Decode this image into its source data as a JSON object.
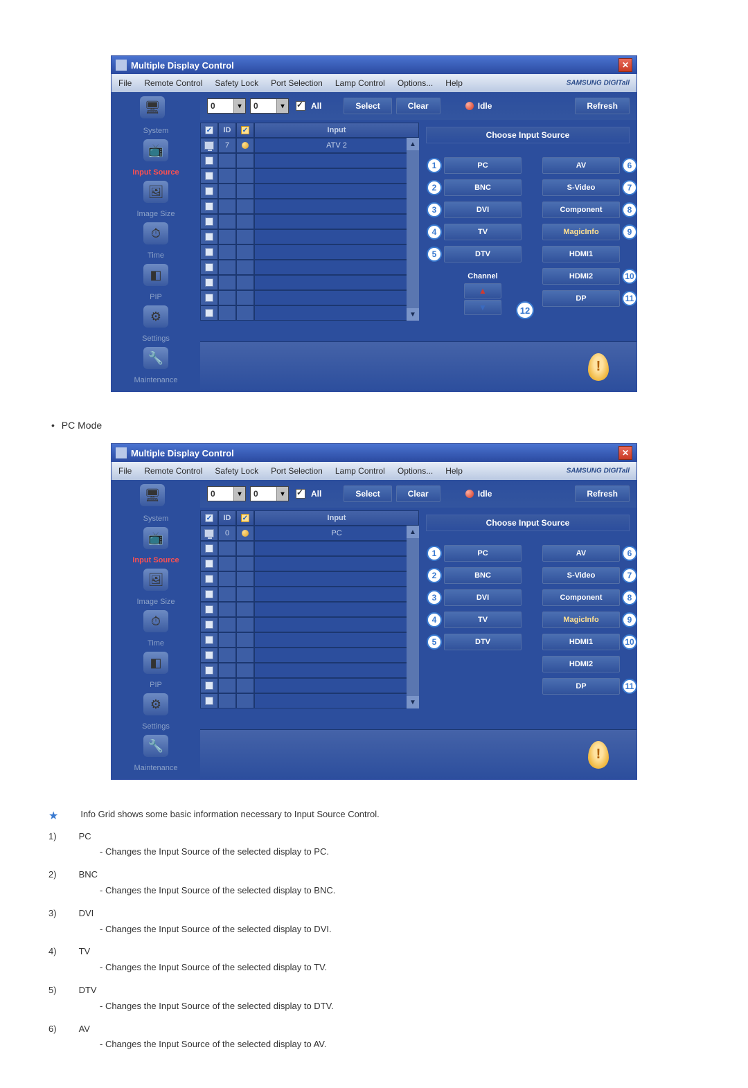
{
  "window": {
    "title": "Multiple Display Control",
    "brand": "SAMSUNG DIGITall"
  },
  "menu": {
    "file": "File",
    "remote": "Remote Control",
    "safety": "Safety Lock",
    "port": "Port Selection",
    "lamp": "Lamp Control",
    "options": "Options...",
    "help": "Help"
  },
  "toolbar": {
    "drop1": "0",
    "drop2": "0",
    "all_label": "All",
    "select": "Select",
    "clear": "Clear",
    "idle": "Idle",
    "refresh": "Refresh"
  },
  "sidebar": {
    "items": [
      {
        "label": "System"
      },
      {
        "label": "Input Source"
      },
      {
        "label": "Image Size"
      },
      {
        "label": "Time"
      },
      {
        "label": "PIP"
      },
      {
        "label": "Settings"
      },
      {
        "label": "Maintenance"
      }
    ]
  },
  "grid": {
    "headers": {
      "id": "ID",
      "input": "Input"
    },
    "screenshot1": {
      "row_id": "7",
      "row_input": "ATV 2"
    },
    "screenshot2": {
      "row_id": "0",
      "row_input": "PC"
    }
  },
  "right_panel": {
    "header": "Choose Input Source",
    "left_col": [
      "PC",
      "BNC",
      "DVI",
      "TV",
      "DTV"
    ],
    "right_col_full": [
      "AV",
      "S-Video",
      "Component",
      "MagicInfo",
      "HDMI1",
      "HDMI2",
      "DP"
    ],
    "right_col_second_extra": [
      "AV",
      "S-Video",
      "Component",
      "MagicInfo",
      "HDMI1",
      "HDMI2",
      "DP"
    ],
    "channel_label": "Channel"
  },
  "callouts": {
    "c1": "1",
    "c2": "2",
    "c3": "3",
    "c4": "4",
    "c5": "5",
    "c6": "6",
    "c7": "7",
    "c8": "8",
    "c9": "9",
    "c10": "10",
    "c11": "11",
    "c12": "12"
  },
  "mode_label": "PC Mode",
  "explain": {
    "star_text": "Info Grid shows some basic information necessary to Input Source Control.",
    "items": [
      {
        "num": "1)",
        "title": "PC",
        "desc": "- Changes the Input Source of the selected display to PC."
      },
      {
        "num": "2)",
        "title": "BNC",
        "desc": "- Changes the Input Source of the selected display to BNC."
      },
      {
        "num": "3)",
        "title": "DVI",
        "desc": "- Changes the Input Source of the selected display to DVI."
      },
      {
        "num": "4)",
        "title": "TV",
        "desc": "- Changes the Input Source of the selected display to TV."
      },
      {
        "num": "5)",
        "title": "DTV",
        "desc": "- Changes the Input Source of the selected display to DTV."
      },
      {
        "num": "6)",
        "title": "AV",
        "desc": "- Changes the Input Source of the selected display to AV."
      }
    ]
  }
}
